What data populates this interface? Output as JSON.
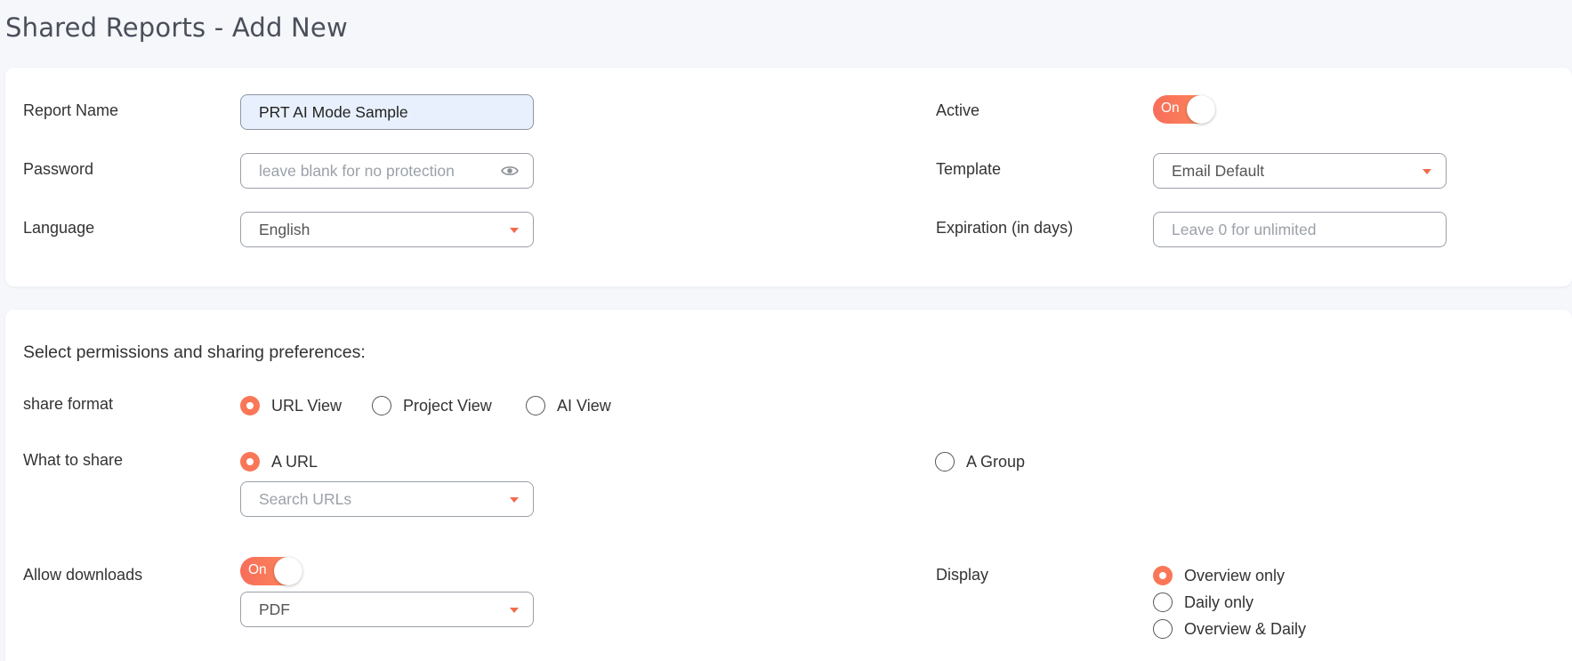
{
  "page": {
    "title": "Shared Reports - Add New"
  },
  "general": {
    "report_name_label": "Report Name",
    "report_name_value": "PRT AI Mode Sample",
    "password_label": "Password",
    "password_placeholder": "leave blank for no protection",
    "language_label": "Language",
    "language_value": "English",
    "active_label": "Active",
    "active_toggle": "On",
    "template_label": "Template",
    "template_value": "Email Default",
    "expiration_label": "Expiration (in days)",
    "expiration_placeholder": "Leave 0 for unlimited"
  },
  "permissions": {
    "heading": "Select permissions and sharing preferences:",
    "share_format_label": "share format",
    "share_format_options": [
      "URL View",
      "Project View",
      "AI View"
    ],
    "share_format_selected": "URL View",
    "what_to_share_label": "What to share",
    "what_to_share_options": [
      "A URL",
      "A Group"
    ],
    "what_to_share_selected": "A URL",
    "search_urls_placeholder": "Search URLs",
    "allow_downloads_label": "Allow downloads",
    "allow_downloads_toggle": "On",
    "download_format_value": "PDF",
    "display_label": "Display",
    "display_options": [
      "Overview only",
      "Daily only",
      "Overview & Daily"
    ],
    "display_selected": "Overview only"
  },
  "colors": {
    "accent": "#f97757",
    "toggle_start": "#f86d5b",
    "toggle_end": "#fd8a58",
    "autofill_bg": "#e8f0fe"
  },
  "icons": {
    "password_reveal": "eye-icon",
    "dropdown": "chevron-down-icon"
  }
}
